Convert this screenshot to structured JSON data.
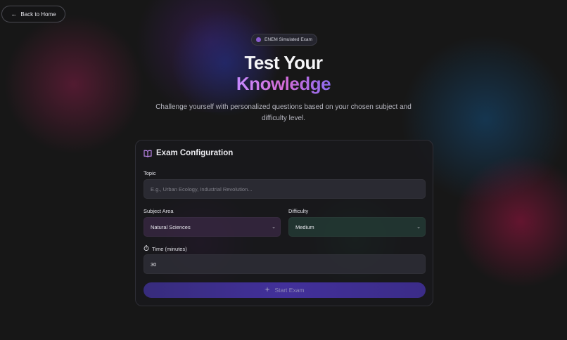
{
  "nav": {
    "back_label": "Back to Home",
    "back_icon": "arrow-left-icon"
  },
  "hero": {
    "badge": "ENEM Simulated Exam",
    "title_line1": "Test Your",
    "title_line2": "Knowledge",
    "subtitle": "Challenge yourself with personalized questions based on your chosen subject and difficulty level."
  },
  "form": {
    "title": "Exam Configuration",
    "title_icon": "book-open-icon",
    "topic": {
      "label": "Topic",
      "value": "",
      "placeholder": "E.g., Urban Ecology, Industrial Revolution..."
    },
    "subject": {
      "label": "Subject Area",
      "selected": "Natural Sciences"
    },
    "difficulty": {
      "label": "Difficulty",
      "selected": "Medium"
    },
    "time": {
      "label": "Time (minutes)",
      "value": "30",
      "icon": "timer-icon"
    },
    "submit_label": "Start Exam",
    "submit_icon": "sparkle-icon"
  },
  "colors": {
    "background": "#171717",
    "accent_gradient": [
      "#c68aff",
      "#d36cd6",
      "#8d6cf0"
    ],
    "button": "#42309a"
  }
}
